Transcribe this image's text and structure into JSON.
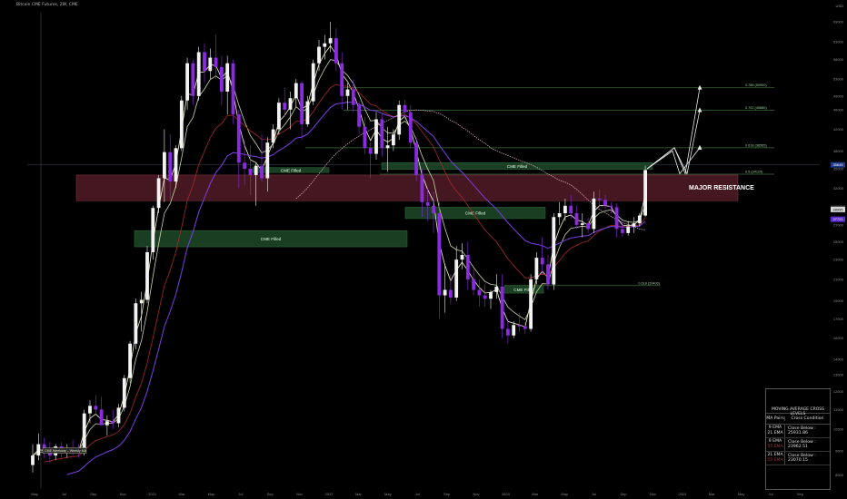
{
  "header": {
    "title": "Bitcoin CME Futures, 2W, CME",
    "currency": "USD"
  },
  "colors": {
    "background": "#000000",
    "candle_up": "#f2f2f2",
    "candle_down": "#8a2be2",
    "ema9": "#f7f4c9",
    "ema21": "#c8d8a8",
    "ema_slow": "#a52a2a",
    "ema_slower": "#7b3fe4",
    "resistance_zone": "#5c1f2b",
    "cme_gap_zone": "#1f4d2a",
    "fib_line": "#3b6e3b"
  },
  "chart_data": {
    "type": "candlestick",
    "y_axis": {
      "scale": "log",
      "ylim": [
        8000,
        72000
      ],
      "tick_labels": [
        "69000",
        "63000",
        "58000",
        "53000",
        "49000",
        "46000",
        "42000",
        "38000",
        "35000",
        "32000",
        "29000",
        "27000",
        "25000",
        "23000",
        "21000",
        "19000",
        "17500",
        "16000",
        "14500",
        "13500",
        "12500",
        "11500",
        "10500",
        "9500",
        "8500"
      ]
    },
    "x_axis": {
      "tick_labels": [
        "May",
        "Jul",
        "Sep",
        "Nov",
        "2021",
        "Mar",
        "May",
        "Jul",
        "Sep",
        "Nov",
        "2022",
        "Mar",
        "May",
        "Jul",
        "Sep",
        "Nov",
        "2023",
        "Mar",
        "May",
        "Jul",
        "Sep",
        "Nov",
        "2024",
        "Mar",
        "May",
        "Jul",
        "Sep"
      ]
    },
    "candles": [
      {
        "o": 8900,
        "h": 9800,
        "l": 8600,
        "c": 9300
      },
      {
        "o": 9300,
        "h": 10300,
        "l": 9100,
        "c": 9800
      },
      {
        "o": 9800,
        "h": 10100,
        "l": 9200,
        "c": 9500
      },
      {
        "o": 9500,
        "h": 9900,
        "l": 9000,
        "c": 9300
      },
      {
        "o": 9300,
        "h": 9800,
        "l": 9100,
        "c": 9700
      },
      {
        "o": 9700,
        "h": 9900,
        "l": 9200,
        "c": 9400
      },
      {
        "o": 9400,
        "h": 9800,
        "l": 9200,
        "c": 9600
      },
      {
        "o": 9600,
        "h": 10000,
        "l": 9300,
        "c": 9500
      },
      {
        "o": 9500,
        "h": 9800,
        "l": 9200,
        "c": 9400
      },
      {
        "o": 9400,
        "h": 11500,
        "l": 9300,
        "c": 11300
      },
      {
        "o": 11300,
        "h": 12000,
        "l": 10800,
        "c": 11700
      },
      {
        "o": 11700,
        "h": 12300,
        "l": 11200,
        "c": 11500
      },
      {
        "o": 11500,
        "h": 12200,
        "l": 10800,
        "c": 10700
      },
      {
        "o": 10700,
        "h": 11200,
        "l": 10200,
        "c": 10900
      },
      {
        "o": 10900,
        "h": 11500,
        "l": 10500,
        "c": 10800
      },
      {
        "o": 10800,
        "h": 11800,
        "l": 10600,
        "c": 11600
      },
      {
        "o": 11600,
        "h": 13500,
        "l": 11400,
        "c": 13300
      },
      {
        "o": 13300,
        "h": 15800,
        "l": 13000,
        "c": 15600
      },
      {
        "o": 15600,
        "h": 19200,
        "l": 15200,
        "c": 18800
      },
      {
        "o": 18800,
        "h": 19800,
        "l": 16500,
        "c": 19100
      },
      {
        "o": 19100,
        "h": 24500,
        "l": 18800,
        "c": 23800
      },
      {
        "o": 23800,
        "h": 29500,
        "l": 23000,
        "c": 29200
      },
      {
        "o": 29200,
        "h": 34000,
        "l": 28500,
        "c": 33500
      },
      {
        "o": 33500,
        "h": 42000,
        "l": 30000,
        "c": 37800
      },
      {
        "o": 37800,
        "h": 41000,
        "l": 30500,
        "c": 33000
      },
      {
        "o": 33000,
        "h": 39000,
        "l": 32000,
        "c": 38500
      },
      {
        "o": 38500,
        "h": 49000,
        "l": 38000,
        "c": 48000
      },
      {
        "o": 48000,
        "h": 58500,
        "l": 46000,
        "c": 57000
      },
      {
        "o": 57000,
        "h": 58000,
        "l": 47000,
        "c": 49000
      },
      {
        "o": 49000,
        "h": 61500,
        "l": 48000,
        "c": 60000
      },
      {
        "o": 60000,
        "h": 62500,
        "l": 52000,
        "c": 55000
      },
      {
        "o": 55000,
        "h": 61000,
        "l": 53000,
        "c": 58500
      },
      {
        "o": 58500,
        "h": 65000,
        "l": 53000,
        "c": 56000
      },
      {
        "o": 56000,
        "h": 59000,
        "l": 47000,
        "c": 50000
      },
      {
        "o": 50000,
        "h": 59000,
        "l": 45000,
        "c": 57000
      },
      {
        "o": 57000,
        "h": 58000,
        "l": 43000,
        "c": 45000
      },
      {
        "o": 45000,
        "h": 46000,
        "l": 32000,
        "c": 36000
      },
      {
        "o": 36000,
        "h": 40000,
        "l": 32500,
        "c": 35000
      },
      {
        "o": 35000,
        "h": 39000,
        "l": 31000,
        "c": 34000
      },
      {
        "o": 34000,
        "h": 36000,
        "l": 29500,
        "c": 35500
      },
      {
        "o": 35500,
        "h": 41000,
        "l": 33000,
        "c": 33500
      },
      {
        "o": 33500,
        "h": 40500,
        "l": 31500,
        "c": 39500
      },
      {
        "o": 39500,
        "h": 43000,
        "l": 38500,
        "c": 42000
      },
      {
        "o": 42000,
        "h": 48500,
        "l": 41000,
        "c": 47500
      },
      {
        "o": 47500,
        "h": 51000,
        "l": 44500,
        "c": 46000
      },
      {
        "o": 46000,
        "h": 50000,
        "l": 42000,
        "c": 48500
      },
      {
        "o": 48500,
        "h": 53000,
        "l": 46500,
        "c": 52000
      },
      {
        "o": 52000,
        "h": 52500,
        "l": 40000,
        "c": 43000
      },
      {
        "o": 43000,
        "h": 49000,
        "l": 42500,
        "c": 47800
      },
      {
        "o": 47800,
        "h": 58000,
        "l": 47000,
        "c": 57000
      },
      {
        "o": 57000,
        "h": 63500,
        "l": 55000,
        "c": 61500
      },
      {
        "o": 61500,
        "h": 65000,
        "l": 58000,
        "c": 62500
      },
      {
        "o": 62500,
        "h": 69000,
        "l": 60000,
        "c": 64000
      },
      {
        "o": 64000,
        "h": 67000,
        "l": 55000,
        "c": 57000
      },
      {
        "o": 57000,
        "h": 60000,
        "l": 46000,
        "c": 49000
      },
      {
        "o": 49000,
        "h": 52000,
        "l": 46000,
        "c": 50500
      },
      {
        "o": 50500,
        "h": 53000,
        "l": 45500,
        "c": 47000
      },
      {
        "o": 47000,
        "h": 48000,
        "l": 41000,
        "c": 42500
      },
      {
        "o": 42500,
        "h": 44500,
        "l": 37500,
        "c": 38500
      },
      {
        "o": 38500,
        "h": 39500,
        "l": 33500,
        "c": 37500
      },
      {
        "o": 37500,
        "h": 45500,
        "l": 36500,
        "c": 44000
      },
      {
        "o": 44000,
        "h": 45000,
        "l": 37000,
        "c": 38500
      },
      {
        "o": 38500,
        "h": 42500,
        "l": 34500,
        "c": 39000
      },
      {
        "o": 39000,
        "h": 42000,
        "l": 38000,
        "c": 41000
      },
      {
        "o": 41000,
        "h": 48000,
        "l": 40000,
        "c": 47000
      },
      {
        "o": 47000,
        "h": 48200,
        "l": 44000,
        "c": 45500
      },
      {
        "o": 45500,
        "h": 47000,
        "l": 38500,
        "c": 39500
      },
      {
        "o": 39500,
        "h": 40500,
        "l": 33000,
        "c": 34000
      },
      {
        "o": 34000,
        "h": 35000,
        "l": 28000,
        "c": 30000
      },
      {
        "o": 30000,
        "h": 32000,
        "l": 27500,
        "c": 29500
      },
      {
        "o": 29500,
        "h": 31500,
        "l": 26000,
        "c": 28500
      },
      {
        "o": 28500,
        "h": 30000,
        "l": 17500,
        "c": 19500
      },
      {
        "o": 19500,
        "h": 22500,
        "l": 18000,
        "c": 20000
      },
      {
        "o": 20000,
        "h": 21500,
        "l": 18700,
        "c": 19300
      },
      {
        "o": 19300,
        "h": 24500,
        "l": 19000,
        "c": 23000
      },
      {
        "o": 23000,
        "h": 24800,
        "l": 22000,
        "c": 23500
      },
      {
        "o": 23500,
        "h": 25000,
        "l": 20000,
        "c": 21000
      },
      {
        "o": 21000,
        "h": 22000,
        "l": 19500,
        "c": 20000
      },
      {
        "o": 20000,
        "h": 21000,
        "l": 18500,
        "c": 19500
      },
      {
        "o": 19500,
        "h": 20500,
        "l": 18500,
        "c": 19200
      },
      {
        "o": 19200,
        "h": 20000,
        "l": 18300,
        "c": 19800
      },
      {
        "o": 19800,
        "h": 21500,
        "l": 19200,
        "c": 20300
      },
      {
        "o": 20300,
        "h": 21500,
        "l": 16000,
        "c": 16700
      },
      {
        "o": 16700,
        "h": 17500,
        "l": 15600,
        "c": 16200
      },
      {
        "o": 16200,
        "h": 17300,
        "l": 16000,
        "c": 17000
      },
      {
        "o": 17000,
        "h": 18000,
        "l": 16500,
        "c": 16900
      },
      {
        "o": 16900,
        "h": 17200,
        "l": 16300,
        "c": 16700
      },
      {
        "o": 16700,
        "h": 21500,
        "l": 16500,
        "c": 21000
      },
      {
        "o": 21000,
        "h": 23800,
        "l": 20500,
        "c": 23200
      },
      {
        "o": 23200,
        "h": 25500,
        "l": 21500,
        "c": 22500
      },
      {
        "o": 22500,
        "h": 23500,
        "l": 20000,
        "c": 20500
      },
      {
        "o": 20500,
        "h": 28500,
        "l": 20000,
        "c": 28000
      },
      {
        "o": 28000,
        "h": 30000,
        "l": 27000,
        "c": 28500
      },
      {
        "o": 28500,
        "h": 30500,
        "l": 27500,
        "c": 29500
      },
      {
        "o": 29500,
        "h": 31000,
        "l": 27800,
        "c": 28500
      },
      {
        "o": 28500,
        "h": 29500,
        "l": 26500,
        "c": 27000
      },
      {
        "o": 27000,
        "h": 28500,
        "l": 25500,
        "c": 27200
      },
      {
        "o": 27200,
        "h": 28000,
        "l": 26000,
        "c": 26500
      },
      {
        "o": 26500,
        "h": 31500,
        "l": 26000,
        "c": 30500
      },
      {
        "o": 30500,
        "h": 31800,
        "l": 29500,
        "c": 30300
      },
      {
        "o": 30300,
        "h": 31000,
        "l": 29000,
        "c": 29500
      },
      {
        "o": 29500,
        "h": 30000,
        "l": 28500,
        "c": 29300
      },
      {
        "o": 29300,
        "h": 29800,
        "l": 25500,
        "c": 26500
      },
      {
        "o": 26500,
        "h": 27500,
        "l": 25500,
        "c": 26000
      },
      {
        "o": 26000,
        "h": 27500,
        "l": 25700,
        "c": 26800
      },
      {
        "o": 26800,
        "h": 28000,
        "l": 26000,
        "c": 27200
      },
      {
        "o": 27200,
        "h": 28500,
        "l": 26800,
        "c": 28200
      },
      {
        "o": 28200,
        "h": 35500,
        "l": 28000,
        "c": 34800
      }
    ],
    "zones": [
      {
        "label": "MAJOR RESISTANCE",
        "kind": "resistance",
        "ymin": 30200,
        "ymax": 34000
      },
      {
        "label": "CME Filled",
        "kind": "cme",
        "ymin": 34400,
        "ymax": 35200
      },
      {
        "label": "CME Filled",
        "kind": "cme",
        "ymin": 27800,
        "ymax": 29300
      },
      {
        "label": "CME Filled",
        "kind": "cme",
        "ymin": 24400,
        "ymax": 26300
      },
      {
        "label": "CME Filled",
        "kind": "cme",
        "ymin": 34900,
        "ymax": 36000
      },
      {
        "label": "CME Filled",
        "kind": "cme",
        "ymin": 19700,
        "ymax": 20400
      }
    ],
    "fib_levels": [
      {
        "label": "0.786 (50900)",
        "value": 50900
      },
      {
        "label": "0.702 (45880)",
        "value": 45880
      },
      {
        "label": "0.618 (38565)",
        "value": 38565
      },
      {
        "label": "0.5 (34129)",
        "value": 34129
      },
      {
        "label": "0.618 (20400)",
        "value": 20400
      }
    ],
    "price_tags": [
      {
        "text": "29175",
        "value": 29175
      },
      {
        "text": "28995",
        "value": 28995
      },
      {
        "text": "27721",
        "value": 27721
      }
    ],
    "current_price_label": "35645",
    "projection_targets": [
      50900,
      45880,
      38565
    ],
    "annotation": "CME Weekday – Weekly MA"
  },
  "ma_table": {
    "title": "MOVING AVERAGE CROSS LEVELS",
    "col_pairs": "MA Pairs",
    "col_condition": "Cross Condition",
    "rows": [
      {
        "a": "9 EMA",
        "b": "21 EMA",
        "condition": "Close Below : 25931.86"
      },
      {
        "a": "9 EMA",
        "b": "55 EMA",
        "condition": "Close Below : 23962.51"
      },
      {
        "a": "21 EMA",
        "b": "55 EMA",
        "condition": "Close Below : 23070.15"
      }
    ]
  }
}
